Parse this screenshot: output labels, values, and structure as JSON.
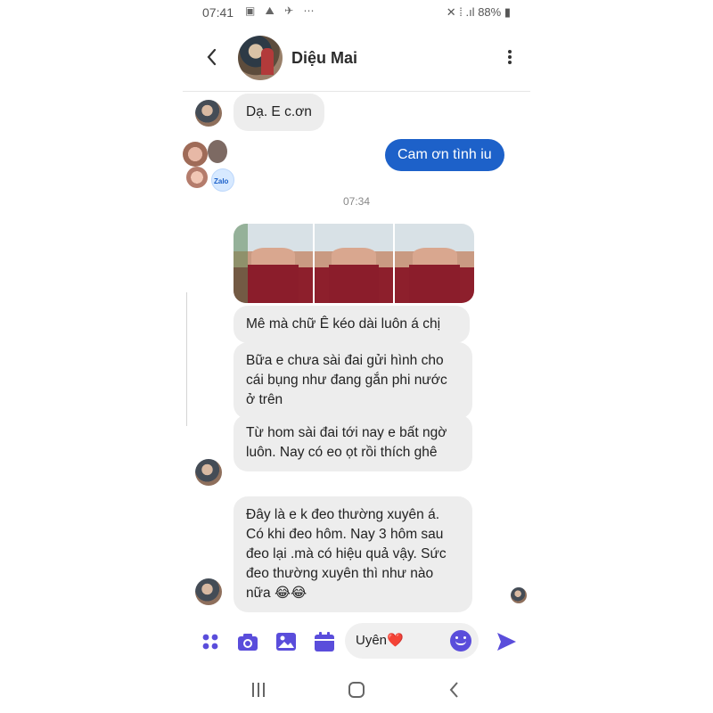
{
  "status": {
    "time": "07:41",
    "battery": "88%",
    "signal_text": "↗ .ıl"
  },
  "header": {
    "contact_name": "Diệu Mai"
  },
  "messages": {
    "m1": "Dạ. E c.ơn",
    "m2_out": "Cam ơn tình iu",
    "timestamp": "07:34",
    "group_avatar_label": "Zalo",
    "m3": "Mê mà chữ Ê kéo dài luôn á chị",
    "m4": "Bữa e chưa sài đai gửi hình cho cái bụng như đang gắn phi nước ở trên",
    "m5": "Từ hom sài đai tới nay e bất ngờ luôn. Nay có eo  ọt rồi thích ghê",
    "m6": "Đây là e k đeo thường xuyên á. Có khi đeo hôm. Nay 3 hôm sau đeo lại .mà có hiệu quả vậy. Sức đeo thường xuyên thì như nào nữa 😂😂"
  },
  "input": {
    "value": "Uyên❤️"
  },
  "colors": {
    "accent": "#5a4ddb",
    "outgoing_bubble": "#1d61c9",
    "incoming_bubble": "#ededed"
  }
}
